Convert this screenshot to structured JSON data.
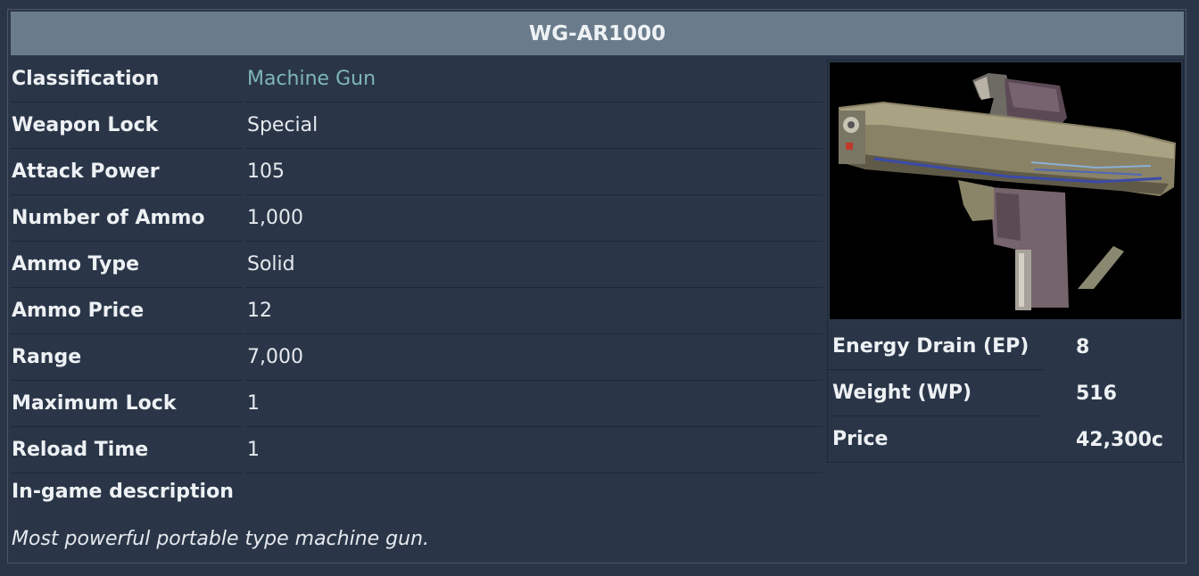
{
  "title": "WG-AR1000",
  "stats": [
    {
      "label": "Classification",
      "value": "Machine Gun",
      "link": true
    },
    {
      "label": "Weapon Lock",
      "value": "Special"
    },
    {
      "label": "Attack Power",
      "value": "105"
    },
    {
      "label": "Number of Ammo",
      "value": "1,000"
    },
    {
      "label": "Ammo Type",
      "value": "Solid"
    },
    {
      "label": "Ammo Price",
      "value": "12"
    },
    {
      "label": "Range",
      "value": "7,000"
    },
    {
      "label": "Maximum Lock",
      "value": "1"
    },
    {
      "label": "Reload Time",
      "value": "1"
    }
  ],
  "description": {
    "heading": "In-game description",
    "text": "Most powerful portable type machine gun."
  },
  "side_stats": [
    {
      "label": "Energy Drain (EP)",
      "value": "8"
    },
    {
      "label": "Weight (WP)",
      "value": "516"
    },
    {
      "label": "Price",
      "value": "42,300c"
    }
  ],
  "image": {
    "icon": "machine-gun-image"
  },
  "colors": {
    "background": "#2a3648",
    "title_bar": "#6a7c8c",
    "link": "#7fb6b8"
  }
}
